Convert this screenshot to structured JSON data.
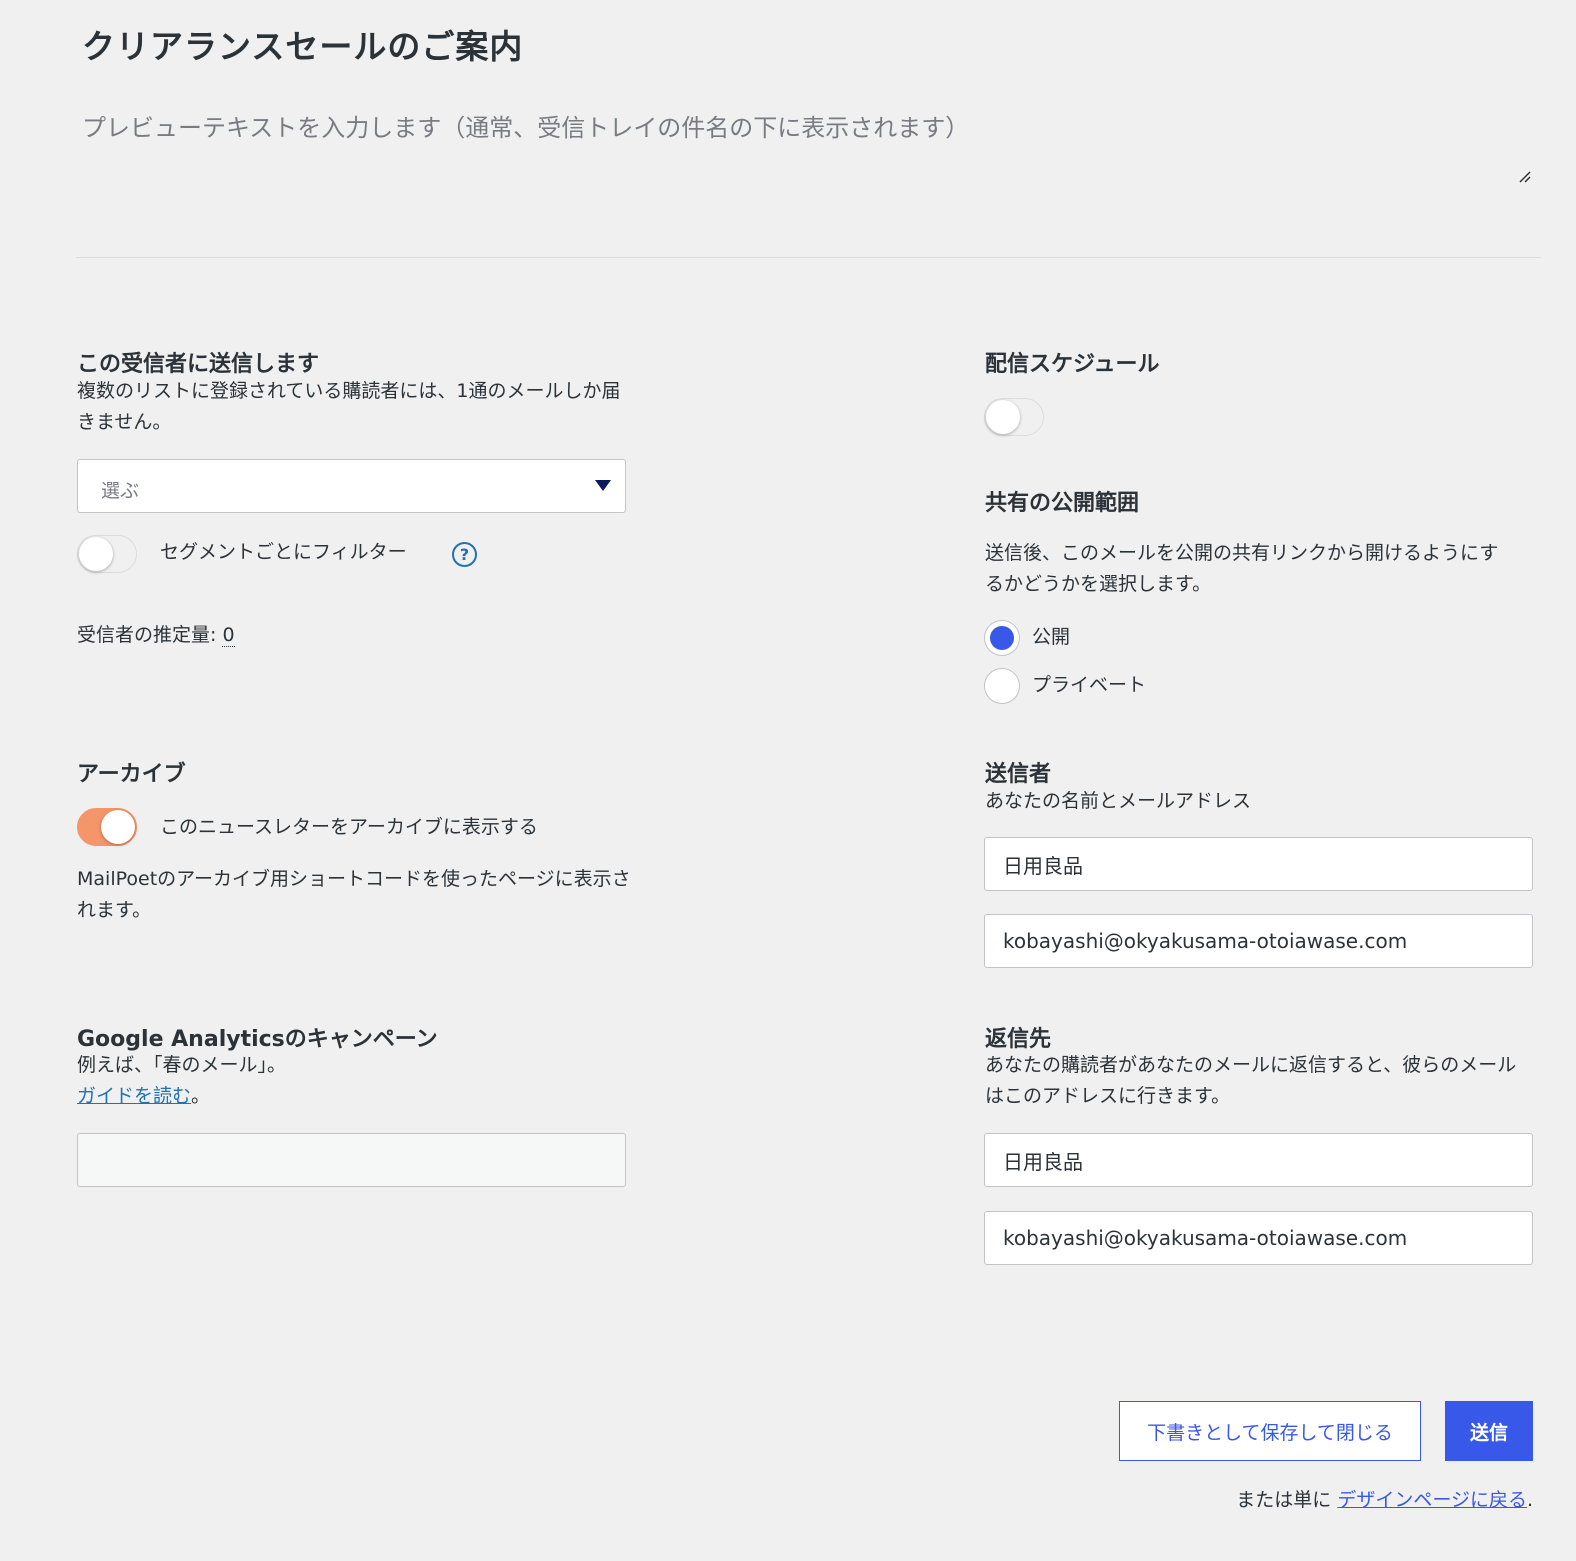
{
  "newsletter": {
    "subject": "クリアランスセールのご案内",
    "preview_placeholder": "プレビューテキストを入力します（通常、受信トレイの件名の下に表示されます）"
  },
  "recipients": {
    "heading": "この受信者に送信します",
    "description": "複数のリストに登録されている購読者には、1通のメールしか届きません。",
    "select_placeholder": "選ぶ",
    "segment_filter_label": "セグメントごとにフィルター",
    "segment_filter_on": false,
    "estimate_label": "受信者の推定量:",
    "estimate_value": "0"
  },
  "archive": {
    "heading": "アーカイブ",
    "toggle_label": "このニュースレターをアーカイブに表示する",
    "toggle_on": true,
    "description": "MailPoetのアーカイブ用ショートコードを使ったページに表示されます。"
  },
  "analytics": {
    "heading": "Google Analyticsのキャンペーン",
    "description": "例えば、「春のメール」。",
    "guide_link": "ガイドを読む",
    "guide_suffix": "。",
    "value": ""
  },
  "schedule": {
    "heading": "配信スケジュール",
    "toggle_on": false
  },
  "visibility": {
    "heading": "共有の公開範囲",
    "description": "送信後、このメールを公開の共有リンクから開けるようにするかどうかを選択します。",
    "options": [
      "公開",
      "プライベート"
    ],
    "selected": "公開"
  },
  "sender": {
    "heading": "送信者",
    "description": "あなたの名前とメールアドレス",
    "name": "日用良品",
    "email": "kobayashi@okyakusama-otoiawase.com"
  },
  "reply_to": {
    "heading": "返信先",
    "description": "あなたの購読者があなたのメールに返信すると、彼らのメールはこのアドレスに行きます。",
    "name": "日用良品",
    "email": "kobayashi@okyakusama-otoiawase.com"
  },
  "actions": {
    "save_draft_label": "下書きとして保存して閉じる",
    "send_label": "送信",
    "footer_prefix": "または単に",
    "footer_link": "デザインページに戻る",
    "footer_suffix": "."
  },
  "colors": {
    "accent": "#3858e9",
    "toggle_on": "#f4956a",
    "link": "#2271b1",
    "background": "#f0f0f1"
  }
}
